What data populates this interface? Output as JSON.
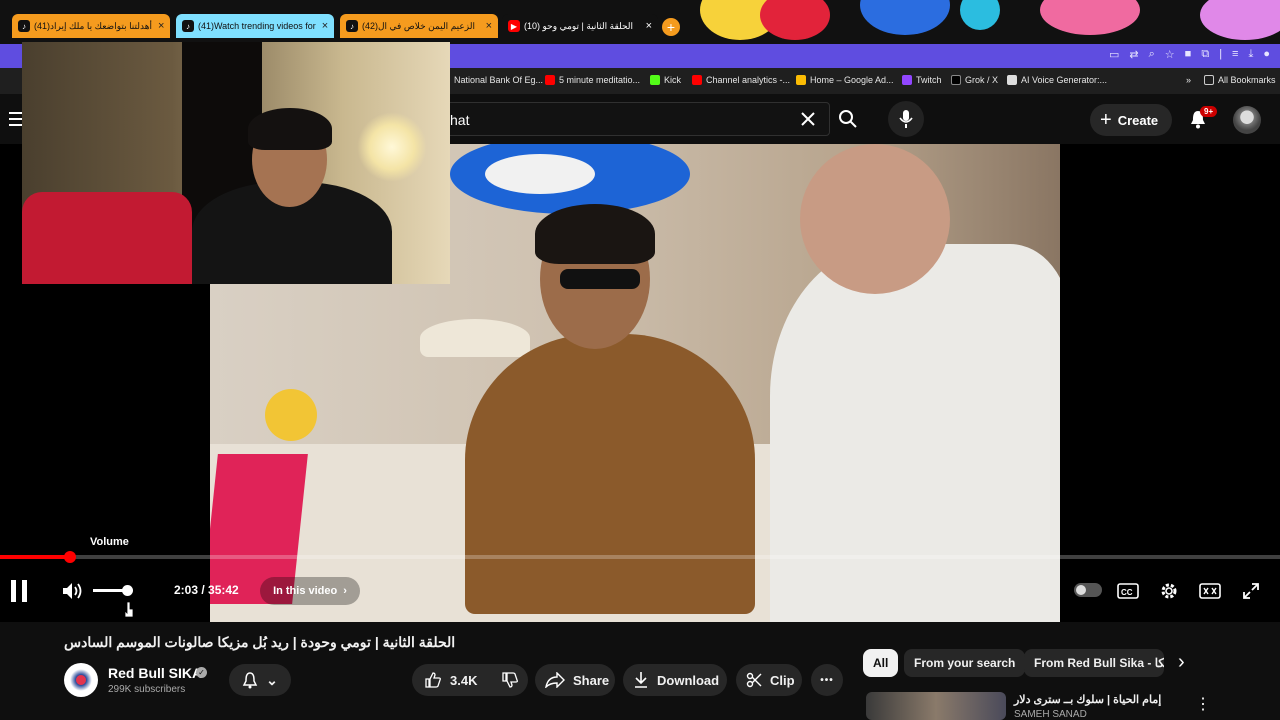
{
  "browser": {
    "tabs": [
      {
        "label": "(41)أهدلتنا بتواضعك يا ملك إيراد",
        "close": "×",
        "color": "#f59b1e",
        "icon_label": "♪"
      },
      {
        "label": "(41)Watch trending videos for",
        "close": "×",
        "color": "#7fe0ff",
        "icon_label": "♪"
      },
      {
        "label": "(42)الزعيم اليمن خلاص في ال",
        "close": "×",
        "color": "#f59b1e",
        "icon_label": "♪"
      },
      {
        "label": "(10) الحلقة الثانية | تومي وحو",
        "close": "×",
        "color": "#111111",
        "icon_label": "▶"
      }
    ],
    "new_tab": "+",
    "bookmarks": [
      {
        "label": "National Bank Of Eg..."
      },
      {
        "label": "5 minute meditatio..."
      },
      {
        "label": "Kick"
      },
      {
        "label": "Channel analytics -..."
      },
      {
        "label": "Home – Google Ad..."
      },
      {
        "label": "Twitch"
      },
      {
        "label": "Grok / X"
      },
      {
        "label": "AI Voice Generator:..."
      }
    ],
    "bookmarks_more": "»",
    "all_bookmarks": "All Bookmarks"
  },
  "youtube": {
    "search_value": "hat",
    "create_label": "Create",
    "notification_badge": "9+"
  },
  "player": {
    "tooltip": "Volume",
    "time": "2:03 / 35:42",
    "in_this_video": "In this video",
    "progress_fraction": 0.055,
    "volume_fraction": 0.95
  },
  "video": {
    "title": "الحلقة الثانية | تومي وحودة | ريد بُل مزيكا صالونات الموسم السادس",
    "channel_name": "Red Bull SIKA",
    "subscribers": "299K subscribers",
    "likes": "3.4K",
    "share_label": "Share",
    "download_label": "Download",
    "clip_label": "Clip",
    "more_label": "•••"
  },
  "sidebar": {
    "chips": [
      {
        "label": "All",
        "active": true
      },
      {
        "label": "From your search",
        "active": false
      },
      {
        "label": "From Red Bull Sika - ريد بُل مزيكا",
        "active": false
      }
    ],
    "next_chevron": "›",
    "recommendation": {
      "title": "إمام الحياة | سلوك بــ سترى دلار",
      "channel": "SAMEH SANAD"
    }
  },
  "colors": {
    "accent_red": "#ff0000",
    "tab_bar_purple": "#5f4de0",
    "chip_active": "#f1f1f1"
  }
}
